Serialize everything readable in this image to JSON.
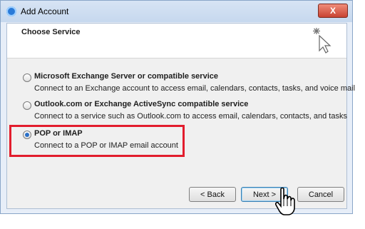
{
  "window": {
    "title": "Add Account",
    "close_symbol": "X"
  },
  "header": {
    "title": "Choose Service",
    "icon": "wizard-sparkle-cursor-icon"
  },
  "options": [
    {
      "title": "Microsoft Exchange Server or compatible service",
      "description": "Connect to an Exchange account to access email, calendars, contacts, tasks, and voice mail",
      "selected": false
    },
    {
      "title": "Outlook.com or Exchange ActiveSync compatible service",
      "description": "Connect to a service such as Outlook.com to access email, calendars, contacts, and tasks",
      "selected": false
    },
    {
      "title": "POP or IMAP",
      "description": "Connect to a POP or IMAP email account",
      "selected": true
    }
  ],
  "buttons": {
    "back": "< Back",
    "next": "Next >",
    "cancel": "Cancel"
  },
  "colors": {
    "highlight": "#e21d2d",
    "radio_selected": "#2b70c8"
  }
}
